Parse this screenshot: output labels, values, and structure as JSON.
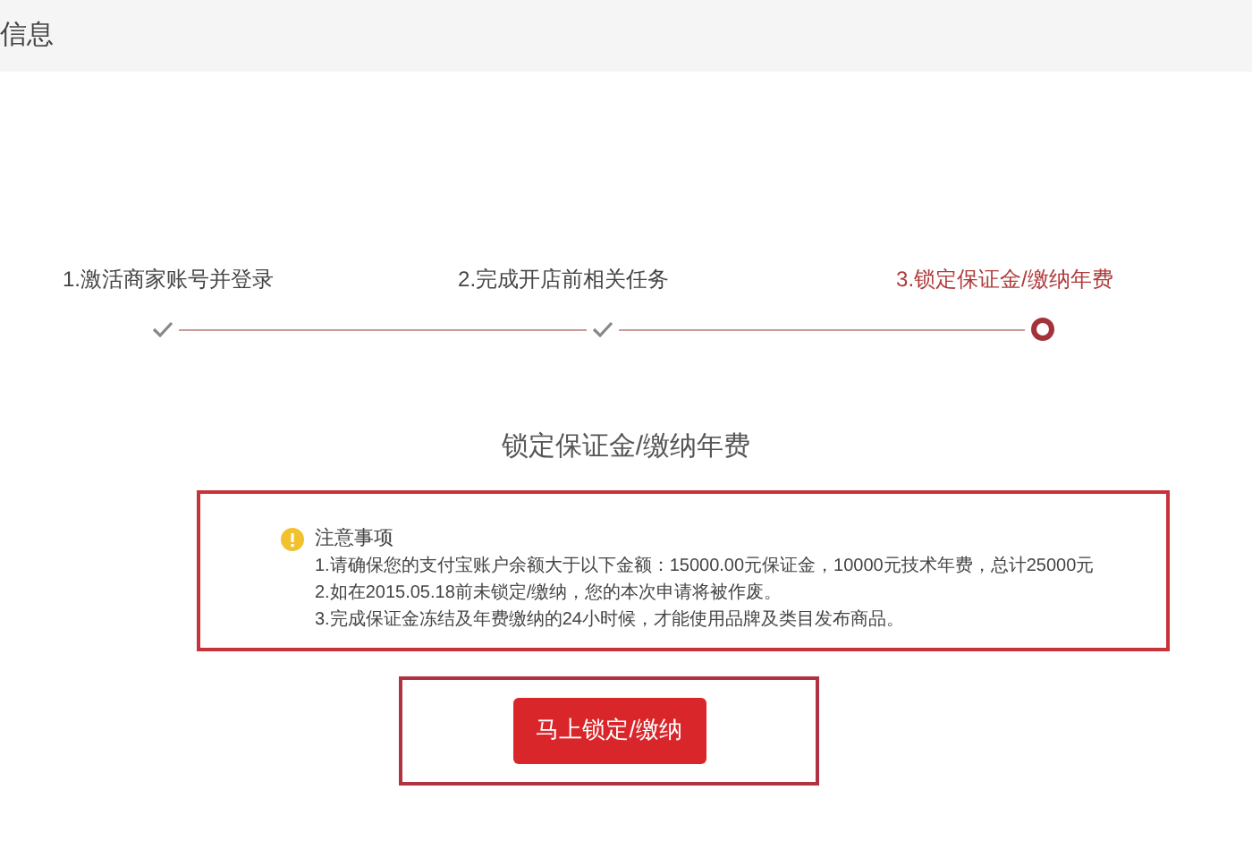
{
  "header": {
    "title": "信息"
  },
  "steps": [
    {
      "label": "1.激活商家账号并登录",
      "completed": true,
      "selected": false
    },
    {
      "label": "2.完成开店前相关任务",
      "completed": true,
      "selected": false
    },
    {
      "label": "3.锁定保证金/缴纳年费",
      "completed": false,
      "selected": true
    }
  ],
  "section_title": "锁定保证金/缴纳年费",
  "notice": {
    "heading": "注意事项",
    "lines": [
      "1.请确保您的支付宝账户余额大于以下金额：15000.00元保证金，10000元技术年费，总计25000元",
      "2.如在2015.05.18前未锁定/缴纳，您的本次申请将被作废。",
      "3.完成保证金冻结及年费缴纳的24小时候，才能使用品牌及类目发布商品。"
    ]
  },
  "button": {
    "label": "马上锁定/缴纳"
  }
}
